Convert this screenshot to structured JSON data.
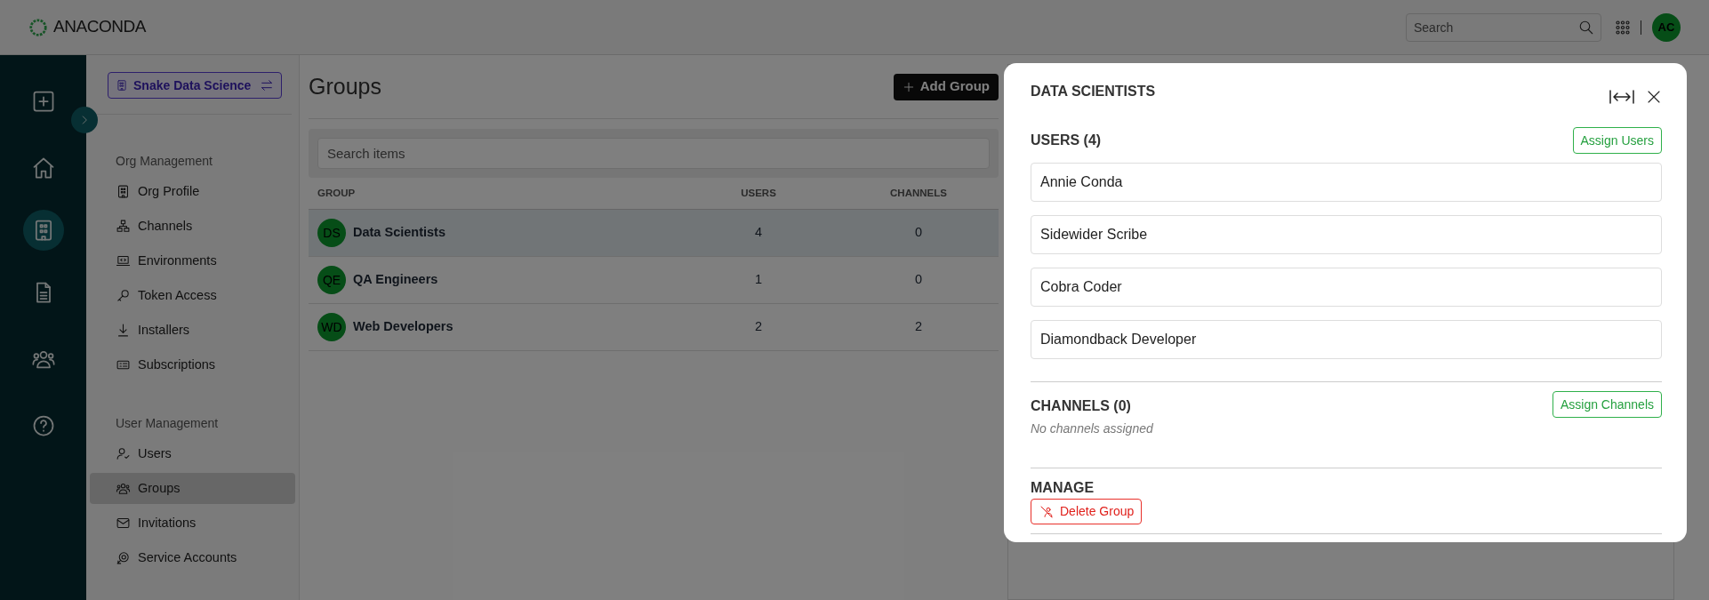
{
  "header": {
    "logo": "ANACONDA",
    "search": {
      "placeholder": "Search"
    },
    "avatar": "AC"
  },
  "rail": [
    {
      "kind": "add",
      "selected": false
    },
    {
      "kind": "home",
      "selected": false
    },
    {
      "kind": "org",
      "selected": true
    },
    {
      "kind": "docs",
      "selected": false
    },
    {
      "kind": "people",
      "selected": false
    },
    {
      "kind": "help",
      "selected": false
    }
  ],
  "org_switcher": {
    "label": "Snake Data Science"
  },
  "sidebar": [
    {
      "title": "Org Management",
      "items": [
        {
          "label": "Org Profile",
          "kind": "org",
          "selected": false
        },
        {
          "label": "Channels",
          "kind": "channels",
          "selected": false
        },
        {
          "label": "Environments",
          "kind": "env",
          "selected": false
        },
        {
          "label": "Token Access",
          "kind": "key",
          "selected": false
        },
        {
          "label": "Installers",
          "kind": "download",
          "selected": false
        },
        {
          "label": "Subscriptions",
          "kind": "subs",
          "selected": false
        }
      ]
    },
    {
      "title": "User Management",
      "items": [
        {
          "label": "Users",
          "kind": "user",
          "selected": false
        },
        {
          "label": "Groups",
          "kind": "people",
          "selected": true
        },
        {
          "label": "Invitations",
          "kind": "mail",
          "selected": false
        },
        {
          "label": "Service Accounts",
          "kind": "service",
          "selected": false
        }
      ]
    }
  ],
  "main": {
    "title": "Groups",
    "add_button": "Add Group",
    "search": {
      "placeholder": "Search items"
    },
    "table": {
      "columns": [
        "GROUP",
        "USERS",
        "CHANNELS"
      ],
      "rows": [
        {
          "initials": "DS",
          "name": "Data Scientists",
          "users": "4",
          "channels": "0",
          "selected": true
        },
        {
          "initials": "QE",
          "name": "QA Engineers",
          "users": "1",
          "channels": "0",
          "selected": false
        },
        {
          "initials": "WD",
          "name": "Web Developers",
          "users": "2",
          "channels": "2",
          "selected": false
        }
      ]
    }
  },
  "drawer": {
    "title": "DATA SCIENTISTS",
    "users_heading": "USERS (4)",
    "assign_users": "Assign Users",
    "users": [
      "Annie Conda",
      "Sidewider Scribe",
      "Cobra Coder",
      "Diamondback Developer"
    ],
    "channels_heading": "CHANNELS (0)",
    "assign_channels": "Assign Channels",
    "channels_empty": "No channels assigned",
    "manage_heading": "MANAGE",
    "delete_button": "Delete Group"
  }
}
